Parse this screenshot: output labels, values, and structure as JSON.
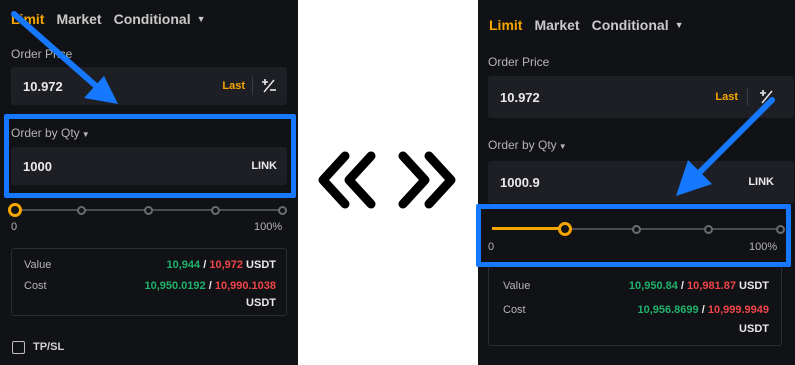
{
  "left": {
    "tabs": {
      "limit": "Limit",
      "market": "Market",
      "conditional": "Conditional"
    },
    "order_price": {
      "label": "Order Price",
      "value": "10.972",
      "last": "Last"
    },
    "order_by_qty": {
      "label": "Order by Qty",
      "value": "1000",
      "unit": "LINK"
    },
    "slider": {
      "min": "0",
      "max": "100%",
      "level_percent": 0
    },
    "value_row": {
      "label": "Value",
      "green": "10,944",
      "sep": "/",
      "red": "10,972",
      "unit": "USDT"
    },
    "cost_row": {
      "label": "Cost",
      "green": "10,950.0192",
      "sep": "/",
      "red": "10,990.1038",
      "unit": "USDT"
    },
    "tpsl": {
      "label": "TP/SL"
    }
  },
  "right": {
    "tabs": {
      "limit": "Limit",
      "market": "Market",
      "conditional": "Conditional"
    },
    "order_price": {
      "label": "Order Price",
      "value": "10.972",
      "last": "Last"
    },
    "order_by_qty": {
      "label": "Order by Qty",
      "value": "1000.9",
      "unit": "LINK"
    },
    "slider": {
      "min": "0",
      "max": "100%",
      "level_percent": 25
    },
    "value_row": {
      "label": "Value",
      "green": "10,950.84",
      "sep": "/",
      "red": "10,981.87",
      "unit": "USDT"
    },
    "cost_row": {
      "label": "Cost",
      "green": "10,956.8699",
      "sep": "/",
      "red": "10,999.9949",
      "unit": "USDT"
    }
  },
  "colors": {
    "accent": "#f7a600",
    "highlight": "#1677ff",
    "green": "#20b26c",
    "red": "#ef454a",
    "panel_bg": "#111215"
  },
  "icons": {
    "tab_dropdown": "caret-down-icon",
    "price_toggle": "plus-minus-icon",
    "arrow": "annotation-arrow-icon",
    "swap": "double-chevron-icon"
  }
}
